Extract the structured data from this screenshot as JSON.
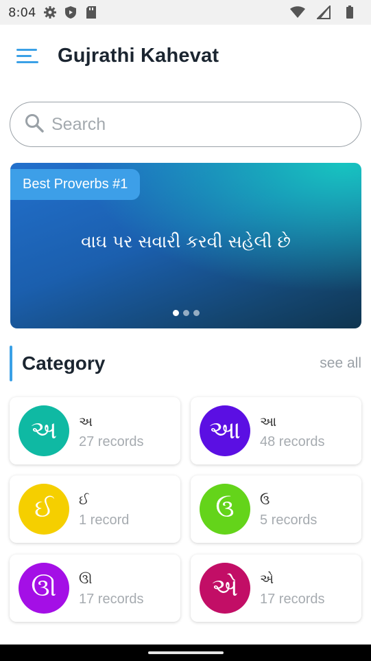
{
  "status_bar": {
    "time": "8:04",
    "icons": [
      "gear-icon",
      "shield-icon",
      "sd-card-icon",
      "wifi-icon",
      "signal-icon",
      "battery-icon"
    ]
  },
  "app_bar": {
    "title": "Gujrathi Kahevat",
    "menu_icon": "menu-icon"
  },
  "search": {
    "placeholder": "Search",
    "icon": "search-icon"
  },
  "banner": {
    "badge": "Best Proverbs #1",
    "text": "વાઘ પર સવારી કરવી સહેલી છે",
    "active_slide": 1,
    "slides": 3
  },
  "category": {
    "title": "Category",
    "see_all": "see all",
    "accent": "#3aa0e6",
    "items": [
      {
        "letter": "અ",
        "count": "27 records",
        "color": "#0fb9a3"
      },
      {
        "letter": "આ",
        "count": "48 records",
        "color": "#5b0fe3"
      },
      {
        "letter": "ઈ",
        "count": "1 record",
        "color": "#f5cf00"
      },
      {
        "letter": "ઉ",
        "count": "5 records",
        "color": "#64d41a"
      },
      {
        "letter": "ઊ",
        "count": "17 records",
        "color": "#a40fe6"
      },
      {
        "letter": "એ",
        "count": "17 records",
        "color": "#c20e66"
      }
    ]
  }
}
